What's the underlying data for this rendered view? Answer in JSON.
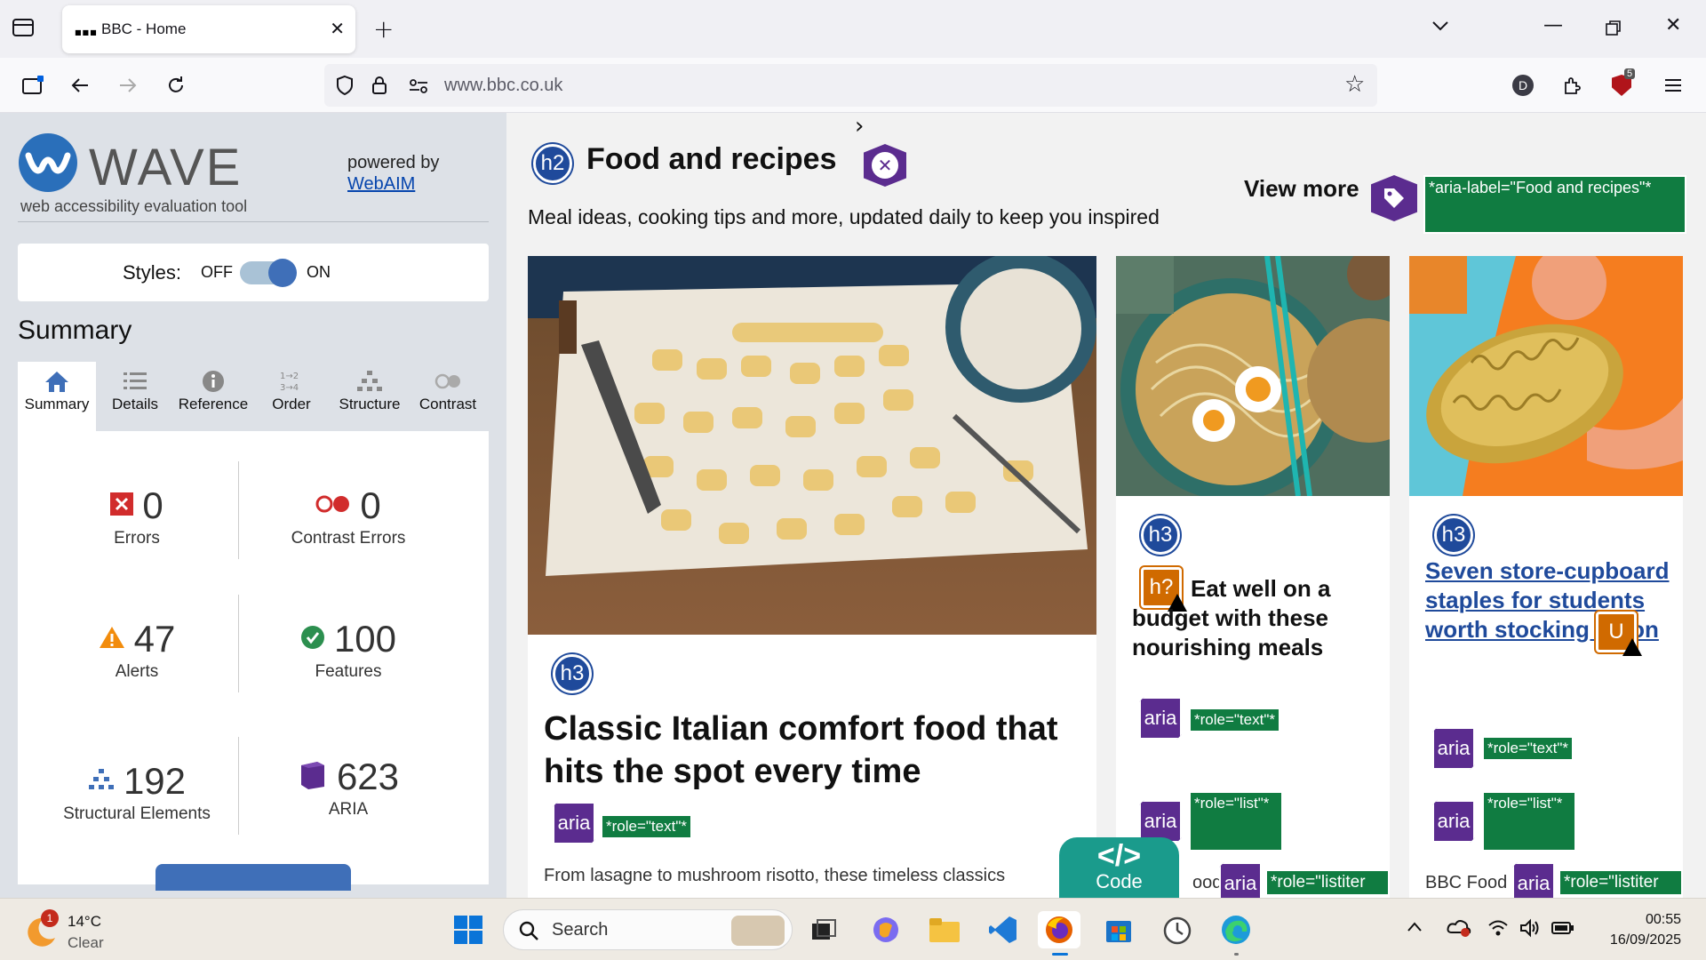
{
  "browser": {
    "tab_title": "BBC - Home",
    "url": "www.bbc.co.uk",
    "ext_badge_count": "5",
    "profile_initial": "D"
  },
  "wave": {
    "title": "WAVE",
    "tagline": "web accessibility evaluation tool",
    "powered_by": "powered by",
    "powered_link": "WebAIM",
    "styles_label": "Styles:",
    "styles_off": "OFF",
    "styles_on": "ON",
    "summary_heading": "Summary",
    "tabs": [
      {
        "label": "Summary"
      },
      {
        "label": "Details"
      },
      {
        "label": "Reference"
      },
      {
        "label": "Order"
      },
      {
        "label": "Structure"
      },
      {
        "label": "Contrast"
      }
    ],
    "stats": {
      "errors": {
        "value": "0",
        "label": "Errors"
      },
      "contrast_errors": {
        "value": "0",
        "label": "Contrast Errors"
      },
      "alerts": {
        "value": "47",
        "label": "Alerts"
      },
      "features": {
        "value": "100",
        "label": "Features"
      },
      "structural": {
        "value": "192",
        "label": "Structural Elements"
      },
      "aria": {
        "value": "623",
        "label": "ARIA"
      }
    }
  },
  "page": {
    "section_badge": "h2",
    "section_title": "Food and recipes",
    "section_desc": "Meal ideas, cooking tips and more, updated daily to keep you inspired",
    "view_more": "View more",
    "view_more_aria": "*aria-label=\"Food and recipes\"*",
    "cards": [
      {
        "badge": "h3",
        "title": "Classic Italian comfort food that hits the spot every time",
        "aria": "aria",
        "role_text": "*role=\"text\"*",
        "summary": "From lasagne to mushroom risotto, these timeless classics"
      },
      {
        "badge": "h3",
        "alert_badge": "h?",
        "title": "Eat well on a budget with these nourishing meals",
        "aria": "aria",
        "role_text": "*role=\"text\"*",
        "role_list": "*role=\"list\"*",
        "source_fragment": "ood",
        "role_listitem": "*role=\"listiter"
      },
      {
        "badge": "h3",
        "alert_badge": "U",
        "title": "Seven store-cupboard staples for students worth stocking up on",
        "aria": "aria",
        "role_text": "*role=\"text\"*",
        "role_list": "*role=\"list\"*",
        "source": "BBC Food",
        "role_listitem": "*role=\"listiter"
      }
    ],
    "code_tab": "Code"
  },
  "taskbar": {
    "weather_temp": "14°C",
    "weather_desc": "Clear",
    "weather_badge": "1",
    "search_placeholder": "Search",
    "time": "00:55",
    "date": "16/09/2025"
  },
  "colors": {
    "wave_blue": "#3f6fb8",
    "heading_badge": "#1f4a9b",
    "aria_purple": "#5b2c8f",
    "label_green": "#107c41",
    "alert_orange": "#d06a00",
    "code_teal": "#1a9b8c"
  }
}
